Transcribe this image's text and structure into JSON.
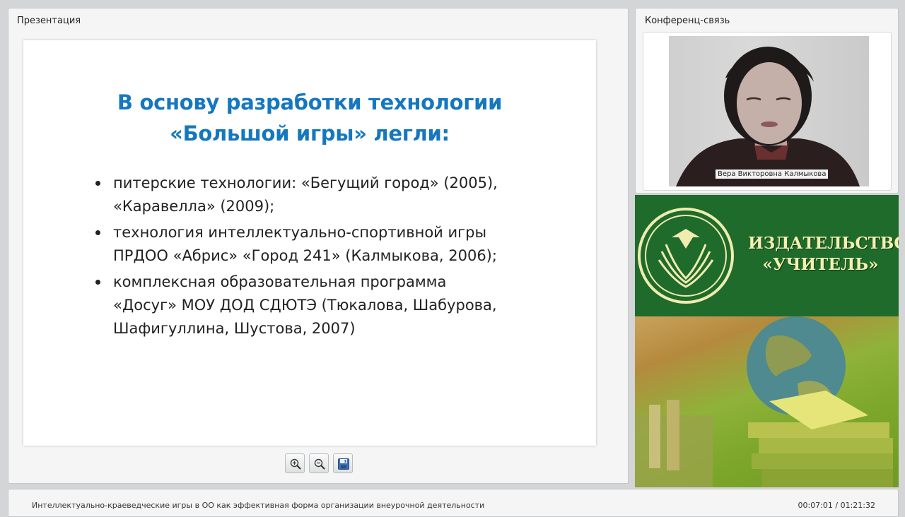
{
  "presentation_panel": {
    "title": "Презентация",
    "slide": {
      "title_lines": [
        "В основу разработки технологии",
        "«Большой игры» легли:"
      ],
      "bullets": [
        {
          "lines": [
            "питерские технологии: «Бегущий город» (2005),",
            "«Каравелла» (2009);"
          ]
        },
        {
          "lines": [
            "технология интеллектуально-спортивной игры",
            "ПРДОО «Абрис» «Город 241» (Калмыкова, 2006);"
          ]
        },
        {
          "lines": [
            "комплексная образовательная программа",
            "«Досуг» МОУ ДОД СДЮТЭ (Тюкалова, Шабурова,",
            "Шафигуллина, Шустова, 2007)"
          ]
        }
      ],
      "title_color": "#1577bf"
    },
    "toolbar": [
      {
        "name": "zoom-in-icon"
      },
      {
        "name": "zoom-out-icon"
      },
      {
        "name": "save-icon"
      }
    ]
  },
  "conference_panel": {
    "title": "Конференц-связь",
    "speaker_name": "Вера Викторовна Калмыкова"
  },
  "banner": {
    "publisher_line1": "ИЗДАТЕЛЬСТВО",
    "publisher_line2": "«УЧИТЕЛЬ»",
    "background_color": "#1f6b2c",
    "text_color": "#f4f0b0"
  },
  "footer": {
    "title": "Интеллектуально-краеведческие игры в ОО как эффективная форма организации внеурочной деятельности",
    "time": "00:07:01 / 01:21:32"
  }
}
